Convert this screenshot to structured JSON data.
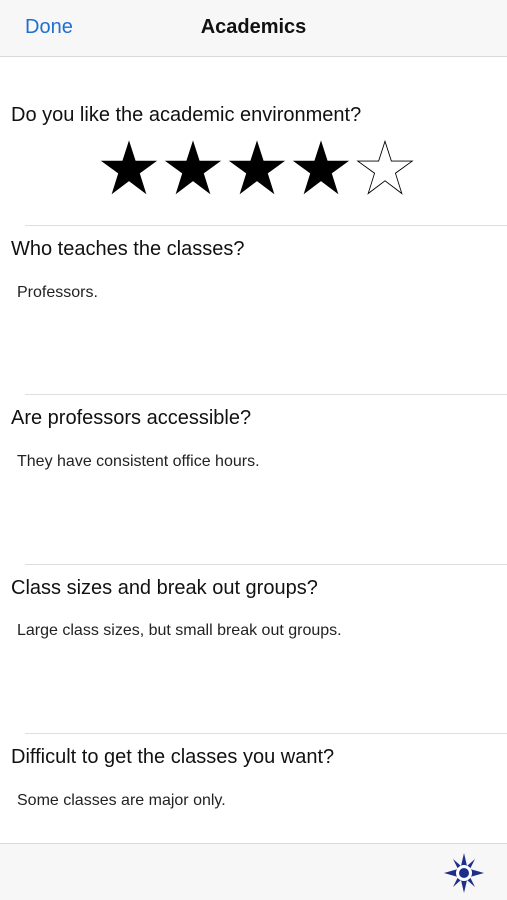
{
  "navbar": {
    "done_label": "Done",
    "title": "Academics"
  },
  "rating": {
    "question": "Do you like the academic environment?",
    "value": 4,
    "max": 5
  },
  "qa": [
    {
      "question": "Who teaches the classes?",
      "answer": "Professors."
    },
    {
      "question": "Are professors accessible?",
      "answer": "They have consistent office hours."
    },
    {
      "question": "Class sizes and break out groups?",
      "answer": "Large class sizes, but small break out groups."
    },
    {
      "question": "Difficult to get the classes you want?",
      "answer": "Some classes are major only."
    }
  ],
  "toolbar": {
    "icon": "compass-icon",
    "icon_color": "#1e2f8a"
  },
  "colors": {
    "accent": "#1f6fd1"
  }
}
